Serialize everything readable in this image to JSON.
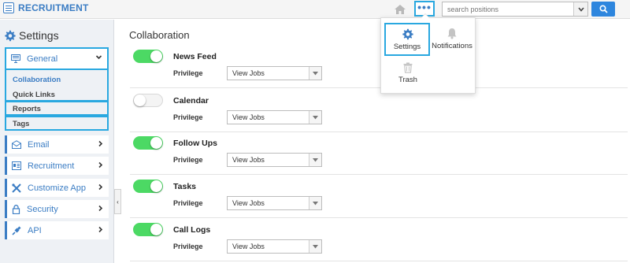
{
  "app": {
    "title": "RECRUITMENT"
  },
  "topbar": {
    "search_placeholder": "search positions"
  },
  "sidebar": {
    "header": "Settings",
    "general": {
      "label": "General",
      "items": [
        {
          "label": "Collaboration",
          "active": true
        },
        {
          "label": "Quick Links"
        },
        {
          "label": "Reports"
        },
        {
          "label": "Tags"
        }
      ]
    },
    "menu": [
      {
        "label": "Email",
        "icon": "email-icon"
      },
      {
        "label": "Recruitment",
        "icon": "recruitment-icon"
      },
      {
        "label": "Customize App",
        "icon": "wrench-icon"
      },
      {
        "label": "Security",
        "icon": "lock-icon"
      },
      {
        "label": "API",
        "icon": "plug-icon"
      }
    ]
  },
  "main": {
    "title": "Collaboration",
    "privilege_label": "Privilege",
    "rows": [
      {
        "name": "News Feed",
        "enabled": true,
        "privilege": "View Jobs"
      },
      {
        "name": "Calendar",
        "enabled": false,
        "privilege": "View Jobs"
      },
      {
        "name": "Follow Ups",
        "enabled": true,
        "privilege": "View Jobs"
      },
      {
        "name": "Tasks",
        "enabled": true,
        "privilege": "View Jobs"
      },
      {
        "name": "Call Logs",
        "enabled": true,
        "privilege": "View Jobs"
      }
    ]
  },
  "dropdown": {
    "items": [
      {
        "label": "Settings",
        "icon": "gear-icon"
      },
      {
        "label": "Notifications",
        "icon": "bell-icon"
      },
      {
        "label": "Trash",
        "icon": "trash-icon"
      }
    ]
  },
  "colors": {
    "accent": "#3b7dc4",
    "highlight": "#29a8e0",
    "toggle_on": "#4cd964"
  }
}
